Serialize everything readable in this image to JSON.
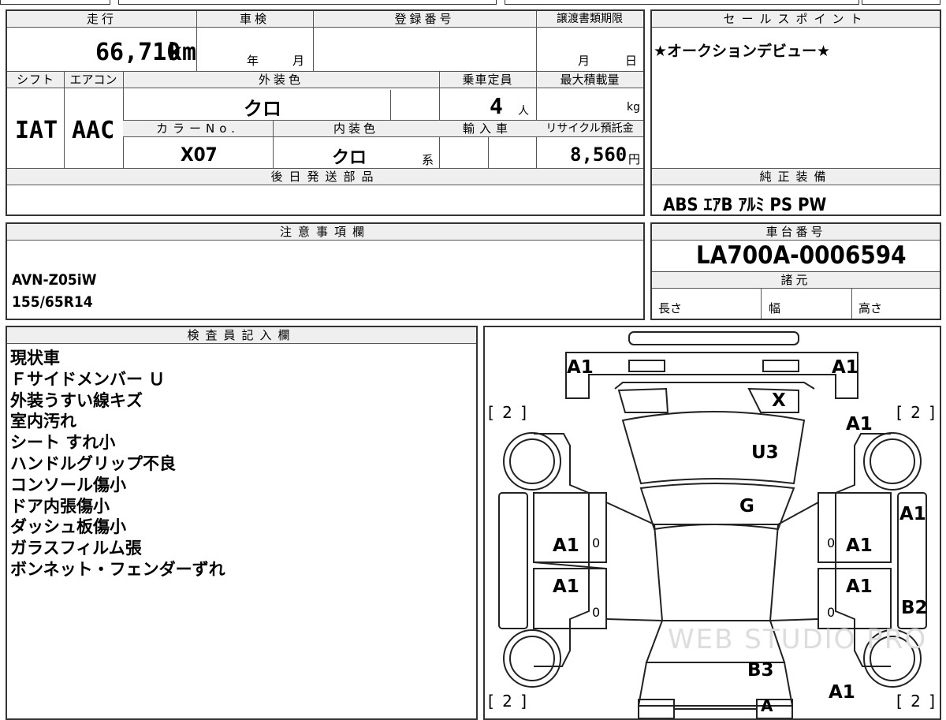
{
  "spec": {
    "headers": {
      "mileage": "走行",
      "shaken": "車検",
      "reg_no": "登録番号",
      "transfer_deadline": "譲渡書類期限",
      "shift": "シフト",
      "aircon": "エアコン",
      "exterior_color": "外装色",
      "capacity": "乗車定員",
      "max_load": "最大積載量",
      "color_no": "カラーNo.",
      "interior_color": "内装色",
      "import": "輸入車",
      "recycle_fee": "リサイクル預託金",
      "later_parts": "後日発送部品"
    },
    "mileage": "66,710",
    "mileage_unit": "km",
    "year_unit": "年",
    "month_unit": "月",
    "deadline_month": "月",
    "deadline_day": "日",
    "shift": "IAT",
    "aircon": "AAC",
    "exterior_color": "クロ",
    "capacity": "4",
    "capacity_unit": "人",
    "load_unit": "kg",
    "color_no": "X07",
    "interior_color": "クロ",
    "interior_suffix": "系",
    "recycle_fee": "8,560",
    "recycle_unit": "円"
  },
  "sales_point": {
    "header": "セールスポイント",
    "text": "★オークションデビュー★"
  },
  "equipment": {
    "header": "純正装備",
    "text": "ABS ｴｱB ｱﾙﾐ PS PW"
  },
  "notes": {
    "header": "注意事項欄",
    "lines": [
      "AVN-Z05iW",
      "155/65R14"
    ]
  },
  "chassis": {
    "header": "車台番号",
    "number": "LA700A-0006594",
    "spec_header": "諸元",
    "length": "長さ",
    "width": "幅",
    "height": "高さ"
  },
  "inspector": {
    "header": "検査員記入欄",
    "lines": [
      "現状車",
      "Ｆサイドメンバー Ｕ",
      "外装うすい線キズ",
      "室内汚れ",
      "シート すれ小",
      "ハンドルグリップ不良",
      "コンソール傷小",
      "ドア内張傷小",
      "ダッシュ板傷小",
      "ガラスフィルム張",
      "ボンネット・フェンダーずれ"
    ]
  },
  "diagram": {
    "labels": [
      "A1",
      "A1",
      "X",
      "A1",
      "U3",
      "G",
      "A1",
      "A1",
      "A1",
      "A1",
      "A1",
      "A1",
      "B2",
      "B3",
      "A1",
      "A"
    ],
    "zeros": [
      "0",
      "0",
      "0",
      "0"
    ],
    "brackets": [
      "[ 2 ]",
      "[ 2 ]",
      "[ 2 ]",
      "[ 2 ]"
    ],
    "watermark": "WEB STUDIO PRO"
  }
}
